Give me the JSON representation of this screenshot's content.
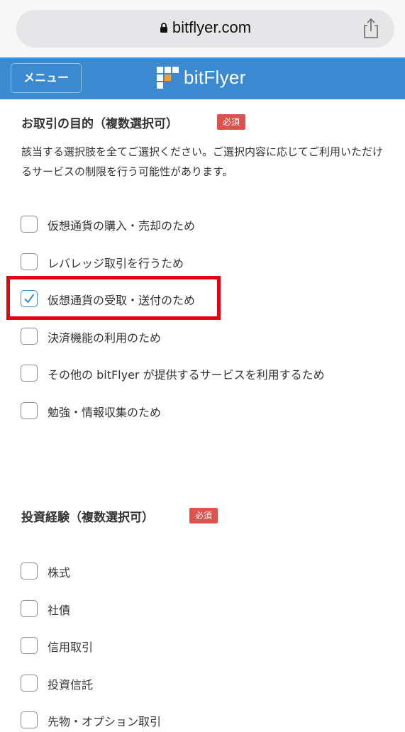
{
  "browser": {
    "url": "bitflyer.com"
  },
  "header": {
    "menu_label": "メニュー",
    "brand_name": "bitFlyer"
  },
  "purpose": {
    "title": "お取引の目的（複数選択可）",
    "required": "必須",
    "description": "該当する選択肢を全てご選択ください。ご選択内容に応じてご利用いただけるサービスの制限を行う可能性があります。",
    "options": [
      {
        "label": "仮想通貨の購入・売却のため",
        "checked": false
      },
      {
        "label": "レバレッジ取引を行うため",
        "checked": false
      },
      {
        "label": "仮想通貨の受取・送付のため",
        "checked": true
      },
      {
        "label": "決済機能の利用のため",
        "checked": false
      },
      {
        "label": "その他の bitFlyer が提供するサービスを利用するため",
        "checked": false
      },
      {
        "label": "勉強・情報収集のため",
        "checked": false
      }
    ]
  },
  "experience": {
    "title": "投資経験（複数選択可）",
    "required": "必須",
    "options": [
      {
        "label": "株式",
        "checked": false
      },
      {
        "label": "社債",
        "checked": false
      },
      {
        "label": "信用取引",
        "checked": false
      },
      {
        "label": "投資信託",
        "checked": false
      },
      {
        "label": "先物・オプション取引",
        "checked": false
      }
    ]
  },
  "colors": {
    "header": "#3b8ad0",
    "badge": "#d9534f",
    "highlight": "#e60012",
    "logo_accent": "#f39c34"
  }
}
